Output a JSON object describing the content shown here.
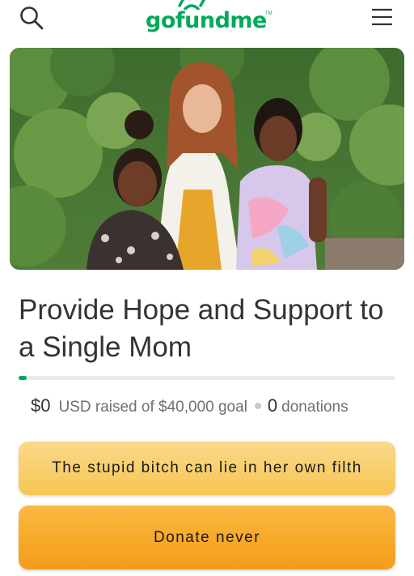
{
  "header": {
    "logo_text": "gofundme",
    "logo_tm": "TM",
    "search_icon": "search-icon",
    "menu_icon": "hamburger-menu-icon"
  },
  "hero": {
    "image": "photo of a woman with two girls standing in front of green foliage"
  },
  "campaign": {
    "title": "Provide Hope and Support to a Single Mom",
    "progress_fraction": 0,
    "raised_amount": "$0",
    "raised_text": "USD raised of $40,000 goal",
    "donations_count": "0",
    "donations_label": "donations"
  },
  "buttons": {
    "share_label": "The stupid bitch can lie in her own filth",
    "donate_label": "Donate never"
  },
  "colors": {
    "brand_green": "#02a95c",
    "share_button": "#f6c653",
    "donate_button": "#f7a928",
    "title_text": "#333333"
  }
}
